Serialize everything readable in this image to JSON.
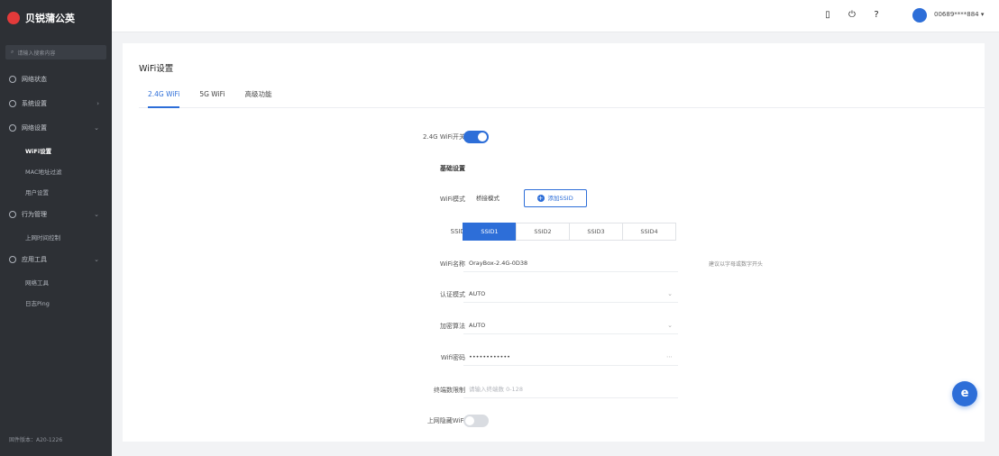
{
  "app": {
    "brand": "贝锐蒲公英"
  },
  "sidebar": {
    "search_placeholder": "请输入搜索内容",
    "items": [
      {
        "label": "网络状态",
        "icon": "dashboard-icon"
      },
      {
        "label": "系统设置",
        "icon": "system-icon"
      },
      {
        "label": "网络设置",
        "icon": "network-icon"
      },
      {
        "label": "WiFi设置",
        "sub": true,
        "active": true
      },
      {
        "label": "MAC地址过滤",
        "sub": true
      },
      {
        "label": "用户设置",
        "sub": true
      },
      {
        "label": "行为管理",
        "icon": "behavior-icon"
      },
      {
        "label": "上网时间控制",
        "sub": true
      },
      {
        "label": "应用工具",
        "icon": "tools-icon"
      },
      {
        "label": "网络工具",
        "sub": true
      },
      {
        "label": "日志Ping",
        "sub": true
      }
    ],
    "footer": "固件版本：A20-1226"
  },
  "header": {
    "icons": [
      "phone-icon",
      "power-icon",
      "help-icon"
    ],
    "username": "00689****884 ▾"
  },
  "page": {
    "title": "WiFi设置",
    "tabs": [
      "2.4G WiFi",
      "5G WiFi",
      "高级功能"
    ],
    "form": {
      "enable_label": "2.4G WiFi开关",
      "enabled": true,
      "basic_label": "基础设置",
      "mode_label": "WiFi模式",
      "mode_option": "桥接模式",
      "add_button": "添加SSID",
      "ssid_label": "SSID",
      "ssid_tabs": [
        "SSID1",
        "SSID2",
        "SSID3",
        "SSID4"
      ],
      "ssid_active_index": 0,
      "name_label": "WiFi名称",
      "name_value": "OrayBox-2.4G-0D38",
      "name_hint": "建议以字母或数字开头",
      "auth_label": "认证模式",
      "auth_value": "AUTO",
      "encrypt_label": "加密算法",
      "encrypt_value": "AUTO",
      "password_label": "Wifi密码",
      "password_value": "••••••••••••",
      "max_clients_label": "终端数限制",
      "max_clients_placeholder": "请输入终端数 0-128",
      "hide_label": "上网隐藏WiFi",
      "hide_enabled": false
    }
  },
  "colors": {
    "accent": "#2d6ed8",
    "sidebar_bg": "#2d3035"
  }
}
